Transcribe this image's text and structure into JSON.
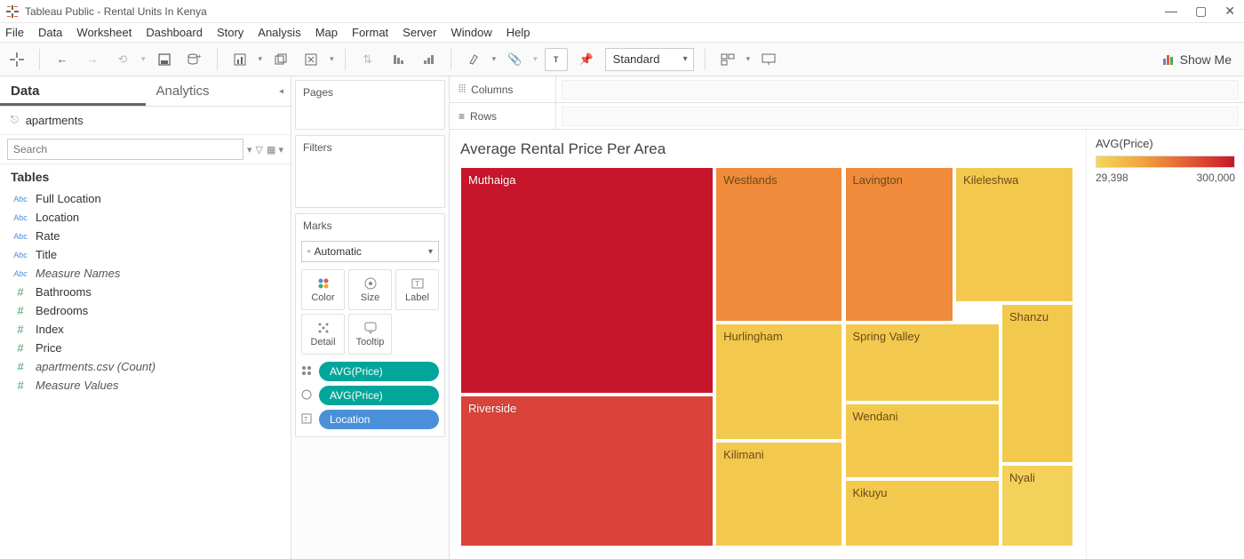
{
  "app_title": "Tableau Public - Rental Units In Kenya",
  "menubar": [
    "File",
    "Data",
    "Worksheet",
    "Dashboard",
    "Story",
    "Analysis",
    "Map",
    "Format",
    "Server",
    "Window",
    "Help"
  ],
  "toolbar": {
    "fit_value": "Standard",
    "showme_label": "Show Me"
  },
  "datapane": {
    "tabs": {
      "data": "Data",
      "analytics": "Analytics"
    },
    "datasource": "apartments",
    "search_placeholder": "Search",
    "tables_heading": "Tables",
    "fields": [
      {
        "icon": "abc",
        "name": "Full Location"
      },
      {
        "icon": "abc",
        "name": "Location"
      },
      {
        "icon": "abc",
        "name": "Rate"
      },
      {
        "icon": "abc",
        "name": "Title"
      },
      {
        "icon": "abc",
        "name": "Measure Names",
        "italic": true
      },
      {
        "icon": "num",
        "name": "Bathrooms"
      },
      {
        "icon": "num",
        "name": "Bedrooms"
      },
      {
        "icon": "num",
        "name": "Index"
      },
      {
        "icon": "num",
        "name": "Price"
      },
      {
        "icon": "num",
        "name": "apartments.csv (Count)",
        "italic": true
      },
      {
        "icon": "num",
        "name": "Measure Values",
        "italic": true
      }
    ]
  },
  "shelves": {
    "pages": "Pages",
    "filters": "Filters",
    "marks": "Marks",
    "mark_type": "Automatic",
    "cards": {
      "color": "Color",
      "size": "Size",
      "label": "Label",
      "detail": "Detail",
      "tooltip": "Tooltip"
    },
    "pills": [
      {
        "icon": "color",
        "label": "AVG(Price)",
        "style": "green"
      },
      {
        "icon": "size",
        "label": "AVG(Price)",
        "style": "green"
      },
      {
        "icon": "label",
        "label": "Location",
        "style": "blue"
      }
    ]
  },
  "colrow": {
    "columns": "Columns",
    "rows": "Rows"
  },
  "viz": {
    "title": "Average Rental Price Per Area"
  },
  "legend": {
    "title": "AVG(Price)",
    "min": "29,398",
    "max": "300,000"
  },
  "chart_data": {
    "type": "treemap",
    "title": "Average Rental Price Per Area",
    "color_scale": {
      "field": "AVG(Price)",
      "min": 29398,
      "max": 300000
    },
    "size_field": "AVG(Price)",
    "cells": [
      {
        "location": "Muthaiga",
        "avg_price": 300000,
        "x": 0,
        "y": 0,
        "w": 41.5,
        "h": 60,
        "color": "#c7162b"
      },
      {
        "location": "Riverside",
        "avg_price": 220000,
        "x": 0,
        "y": 60,
        "w": 41.5,
        "h": 40,
        "color": "#d9433a"
      },
      {
        "location": "Westlands",
        "avg_price": 130000,
        "x": 41.5,
        "y": 0,
        "w": 21,
        "h": 41,
        "color": "#ef8b3a"
      },
      {
        "location": "Lavington",
        "avg_price": 115000,
        "x": 62.5,
        "y": 0,
        "w": 18,
        "h": 41,
        "color": "#ef8b3a"
      },
      {
        "location": "Kileleshwa",
        "avg_price": 80000,
        "x": 80.5,
        "y": 0,
        "w": 19.5,
        "h": 36,
        "color": "#f3c94d"
      },
      {
        "location": "Hurlingham",
        "avg_price": 70000,
        "x": 41.5,
        "y": 41,
        "w": 21,
        "h": 31,
        "color": "#f3c94d"
      },
      {
        "location": "Spring Valley",
        "avg_price": 55000,
        "x": 62.5,
        "y": 41,
        "w": 25.5,
        "h": 21,
        "color": "#f3c94d"
      },
      {
        "location": "Shanzu",
        "avg_price": 50000,
        "x": 88,
        "y": 36,
        "w": 12,
        "h": 42,
        "color": "#f3c94d"
      },
      {
        "location": "Kilimani",
        "avg_price": 50000,
        "x": 41.5,
        "y": 72,
        "w": 21,
        "h": 28,
        "color": "#f3c94d"
      },
      {
        "location": "Wendani",
        "avg_price": 42000,
        "x": 62.5,
        "y": 62,
        "w": 25.5,
        "h": 20,
        "color": "#f3c94d"
      },
      {
        "location": "Kikuyu",
        "avg_price": 35000,
        "x": 62.5,
        "y": 82,
        "w": 25.5,
        "h": 18,
        "color": "#f3c94d"
      },
      {
        "location": "Nyali",
        "avg_price": 29398,
        "x": 88,
        "y": 78,
        "w": 12,
        "h": 22,
        "color": "#f4d15a"
      }
    ]
  }
}
